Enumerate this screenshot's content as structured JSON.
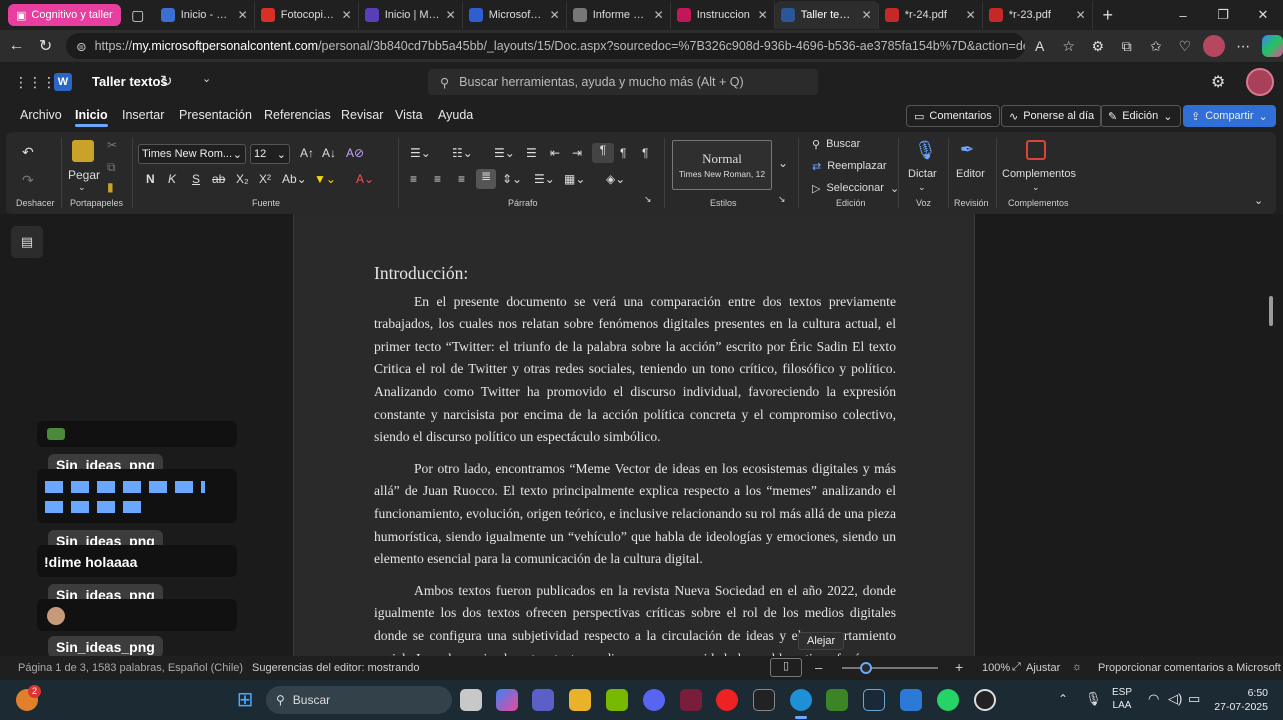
{
  "browser": {
    "tab_group_label": "Cognitivo y taller",
    "tabs": [
      {
        "label": "Inicio - Cam",
        "color": "#3b6fd1"
      },
      {
        "label": "Fotocopia -",
        "color": "#d93025"
      },
      {
        "label": "Inicio | Micr",
        "color": "#5a3db8"
      },
      {
        "label": "Microsoft C",
        "color": "#2e5fd1"
      },
      {
        "label": "Informe bib",
        "color": "#777777"
      },
      {
        "label": "Instruccion",
        "color": "#c2185b"
      },
      {
        "label": "Taller textos",
        "color": "#2b579a",
        "active": true
      },
      {
        "label": "*r-24.pdf",
        "color": "#c62828"
      },
      {
        "label": "*r-23.pdf",
        "color": "#c62828"
      }
    ],
    "url_prefix": "https://",
    "url_host": "my.microsoftpersonalcontent.com",
    "url_path": "/personal/3b840cd7bb5a45bb/_layouts/15/Doc.aspx?sourcedoc=%7B326c908d-936b-4696-b536-ae3785fa154b%7D&action=default"
  },
  "word": {
    "doc_title": "Taller textos",
    "search_placeholder": "Buscar herramientas, ayuda y mucho más (Alt + Q)",
    "menu_tabs": [
      "Archivo",
      "Inicio",
      "Insertar",
      "Presentación",
      "Referencias",
      "Revisar",
      "Vista",
      "Ayuda"
    ],
    "header_buttons": {
      "comments": "Comentarios",
      "catch_up": "Ponerse al día",
      "editing": "Edición",
      "share": "Compartir"
    },
    "ribbon": {
      "undo_group": "Deshacer",
      "paste_label": "Pegar",
      "clipboard_group": "Portapapeles",
      "font_name": "Times New Rom...",
      "font_size": "12",
      "font_group": "Fuente",
      "paragraph_group": "Párrafo",
      "style_name": "Normal",
      "style_desc": "Times New Roman, 12",
      "styles_group": "Estilos",
      "find": "Buscar",
      "replace": "Reemplazar",
      "select": "Seleccionar",
      "edit_group": "Edición",
      "dictate": "Dictar",
      "voice_group": "Voz",
      "editor": "Editor",
      "review_group": "Revisión",
      "addins": "Complementos",
      "addins_group": "Complementos"
    }
  },
  "document": {
    "heading": "Introducción:",
    "paragraphs": [
      "En el presente documento se verá una comparación entre dos textos previamente trabajados, los cuales nos relatan sobre fenómenos digitales presentes en la cultura actual, el primer tecto “Twitter: el triunfo de la palabra sobre la acción” escrito por Éric Sadin El texto Critica el rol de Twitter y otras redes sociales, teniendo un tono crítico, filosófico y político. Analizando como Twitter ha promovido el discurso individual, favoreciendo la expresión constante y narcisista por encima de la acción política concreta y el compromiso colectivo, siendo el discurso político un espectáculo simbólico.",
      "Por otro lado, encontramos “Meme Vector de ideas en los ecosistemas digitales y más allá” de Juan Ruocco. El texto principalmente explica respecto a los “memes” analizando el funcionamiento, evolución, origen teórico, e inclusive relacionando su rol más allá de una pieza humorística, siendo igualmente un “vehículo” que habla de ideologías y emociones, siendo un elemento esencial para la comunicación de la cultura digital.",
      "Ambos textos fueron publicados en la revista Nueva Sociedad en el año 2022, donde igualmente los dos textos ofrecen perspectivas críticas sobre el rol de los medios digitales donde se configura una subjetividad respecto a la circulación de ideas y el comportamiento social. La relevancia de estos textos radica en su capacidad de problematizar fenómenos cotidianos de"
    ]
  },
  "overlay_chat": {
    "username": "Sin_ideas_png",
    "message": "!dime holaaaa"
  },
  "tooltip": "Alejar",
  "statusbar": {
    "page_info": "Página 1 de 3, 1583 palabras, Español (Chile)",
    "editor_suggestions": "Sugerencias del editor: mostrando",
    "zoom": "100%",
    "fit": "Ajustar",
    "feedback": "Proporcionar comentarios a Microsoft"
  },
  "taskbar": {
    "search_placeholder": "Buscar",
    "badge_count": "2",
    "lang_top": "ESP",
    "lang_bottom": "LAA",
    "time": "6:50",
    "date": "27-07-2025"
  }
}
